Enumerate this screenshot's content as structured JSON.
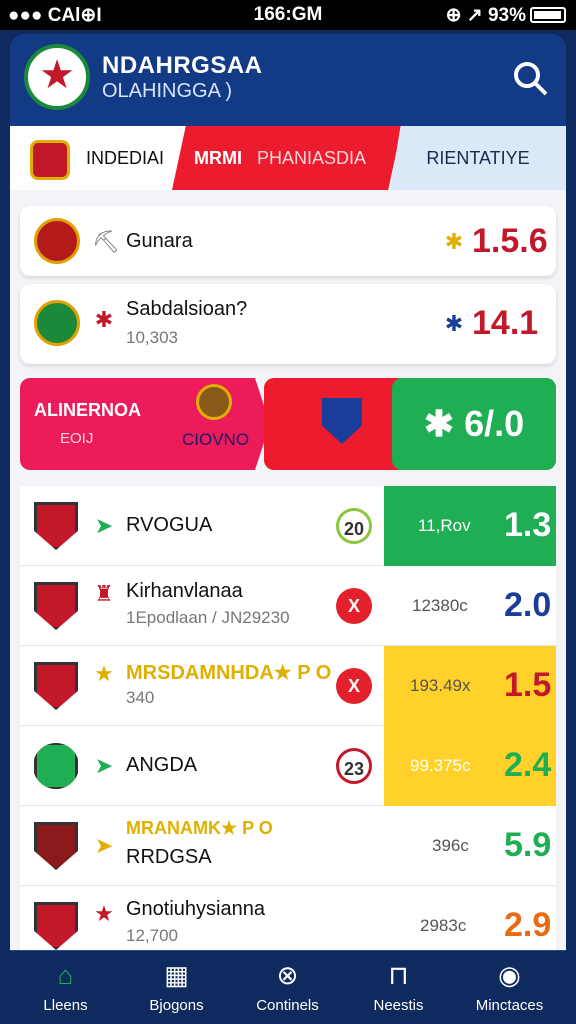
{
  "status": {
    "left": "●●● CAl⊕I",
    "time": "166:GM",
    "right": "⊕ ↗ 93%"
  },
  "header": {
    "title": "NDAHRGSAA",
    "subtitle": "OLAHINGGA )"
  },
  "tabs": {
    "t1": "INDEDIAI",
    "t2a": "MRMI",
    "t2b": "PHANIASDIA",
    "t3": "RIENTATIYE"
  },
  "cards": [
    {
      "name": "Gunara",
      "odd": "1.5.6",
      "icon": "✱",
      "oddColor": "#c3182a"
    },
    {
      "name": "Sabdalsioan?",
      "sub": "10,303",
      "odd": "14.1",
      "icon": "✱",
      "oddColor": "#c3182a"
    }
  ],
  "promo": {
    "left_title": "ALINERNOA",
    "left_sub": "EOIJ",
    "left_cta": "CIOVNO",
    "right_odd": "6/.0"
  },
  "rows": [
    {
      "name": "RVOGUA",
      "circle": "20",
      "mid": "11,Rov",
      "odd": "1.3",
      "bg": "#1fae54",
      "oddColor": "#fff"
    },
    {
      "name": "Kirhanvlanaa",
      "sub": "1Epodlaan / JN29230",
      "circle": "X",
      "mid": "12380c",
      "odd": "2.0",
      "bg": "none",
      "oddColor": "#1a3e9a"
    },
    {
      "name": "MRSDAMNHDA★ P O",
      "sub": "340",
      "circle": "X",
      "mid": "193.49x",
      "odd": "1.5",
      "bg": "#ffd12a",
      "oddColor": "#c3182a"
    },
    {
      "name": "ANGDA",
      "circle": "23",
      "mid": "99.375c",
      "odd": "2.4",
      "bg": "#ffd12a",
      "oddColor": "#1fae54"
    },
    {
      "name": "RRDGSA",
      "tag": "MRANAMK★ P O",
      "mid": "396c",
      "odd": "5.9",
      "bg": "none",
      "oddColor": "#1fae54"
    },
    {
      "name": "Gnotiuhysianna",
      "sub": "12,700",
      "mid": "2983c",
      "odd": "2.9",
      "bg": "none",
      "oddColor": "#e86a12"
    }
  ],
  "nav": [
    "Lleens",
    "Bjogons",
    "Continels",
    "Neestis",
    "Minctaces"
  ]
}
